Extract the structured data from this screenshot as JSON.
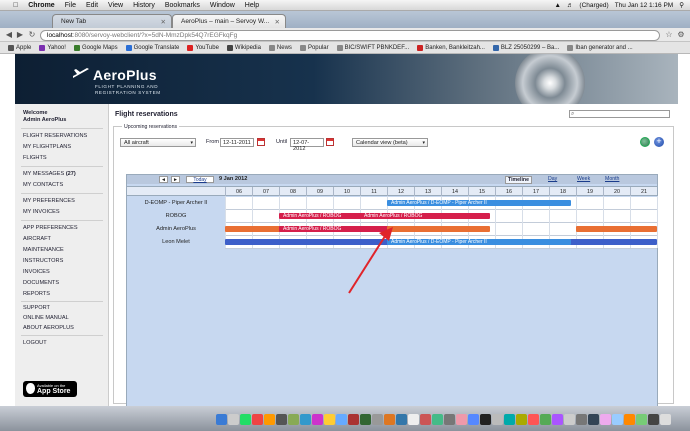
{
  "menubar": {
    "apple": "",
    "items": [
      "Chrome",
      "File",
      "Edit",
      "View",
      "History",
      "Bookmarks",
      "Window",
      "Help"
    ],
    "right": {
      "battery": "(Charged)",
      "clock": "Thu Jan 12  1:16 PM"
    }
  },
  "tabs": [
    {
      "label": "New Tab"
    },
    {
      "label": "AeroPlus – main – Servoy W..."
    }
  ],
  "address": {
    "host": "localhost",
    "path": ":8080/servoy-webclient/?x=5dN-MmzDpk54Q7rEGFkqFg"
  },
  "bookmarks": [
    {
      "label": "Apple",
      "color": "#555"
    },
    {
      "label": "Yahoo!",
      "color": "#7b2fb0"
    },
    {
      "label": "Google Maps",
      "color": "#3a7d2c"
    },
    {
      "label": "Google Translate",
      "color": "#2b6fd6"
    },
    {
      "label": "YouTube",
      "color": "#d22"
    },
    {
      "label": "Wikipedia",
      "color": "#444"
    },
    {
      "label": "News",
      "color": "#888"
    },
    {
      "label": "Popular",
      "color": "#888"
    },
    {
      "label": "BIC/SWIFT PBNKDEF...",
      "color": "#888"
    },
    {
      "label": "Banken, Bankleitzah...",
      "color": "#c22"
    },
    {
      "label": "BLZ 25050299 – Ba...",
      "color": "#36a"
    },
    {
      "label": "Iban generator and ...",
      "color": "#888"
    }
  ],
  "header": {
    "logo_title": "AeroPlus",
    "logo_subtitle": "FLIGHT PLANNING AND REGISTRATION SYSTEM"
  },
  "sidebar": {
    "welcome": "Welcome",
    "user": "Admin AeroPlus",
    "group1": [
      "FLIGHT RESERVATIONS",
      "MY FLIGHTPLANS",
      "FLIGHTS"
    ],
    "messages_label": "MY MESSAGES",
    "messages_count": "(27)",
    "contacts": "MY CONTACTS",
    "group3": [
      "MY PREFERENCES",
      "MY INVOICES"
    ],
    "group4": [
      "APP PREFERENCES",
      "AIRCRAFT",
      "MAINTENANCE",
      "INSTRUCTORS",
      "INVOICES",
      "DOCUMENTS",
      "REPORTS"
    ],
    "group5": [
      "SUPPORT",
      "ONLINE MANUAL",
      "ABOUT AEROPLUS"
    ],
    "logout": "LOGOUT",
    "appstore_line1": "Available on the",
    "appstore_line2": "App Store"
  },
  "main": {
    "title": "Flight reservations",
    "search_placeholder": "",
    "legend": "Upcoming reservations",
    "aircraft_select": "All aircraft",
    "from_label": "From",
    "from_value": "12-11-2011",
    "until_label": "Until",
    "until_value": "12-07-2012",
    "view_select": "Calendar view (beta)"
  },
  "calendar": {
    "today_label": "Today",
    "prev_label": "◄",
    "next_label": "►",
    "date_title": "9 Jan 2012",
    "views": [
      "Timeline",
      "Day",
      "Week",
      "Month"
    ],
    "active_view": "Timeline",
    "days": [
      "06",
      "07",
      "08",
      "09",
      "10",
      "11",
      "12",
      "13",
      "14",
      "15",
      "16",
      "17",
      "18",
      "19",
      "20",
      "21"
    ],
    "rows": [
      {
        "label": "D-EOMP - Piper Archer II"
      },
      {
        "label": "ROBOG"
      },
      {
        "label": "Admin AeroPlus"
      },
      {
        "label": "Leon Melet"
      }
    ],
    "bars": [
      {
        "row": 0,
        "start": 12,
        "end": 17.8,
        "label": "Admin AeroPlus / D-EOMP - Piper Archer II",
        "color": "#3a8ee0"
      },
      {
        "row": 1,
        "start": 8,
        "end": 13.8,
        "label": "Admin AeroPlus / ROBOG",
        "color": "#d51f4b"
      },
      {
        "row": 1,
        "start": 11,
        "end": 14.8,
        "label": "Admin AeroPlus / ROBOG",
        "color": "#d51f4b"
      },
      {
        "row": 2,
        "start": 6,
        "end": 7.5,
        "label": "",
        "color": "#e96f33"
      },
      {
        "row": 2,
        "start": 8,
        "end": 13.8,
        "label": "Admin AeroPlus / ROBOG",
        "color": "#d51f4b"
      },
      {
        "row": 2,
        "start": 12,
        "end": 14.8,
        "label": "",
        "color": "#e96f33"
      },
      {
        "row": 2,
        "start": 19,
        "end": 21.9,
        "label": "",
        "color": "#e96f33"
      },
      {
        "row": 3,
        "start": 6,
        "end": 21.9,
        "label": "",
        "color": "#3d5fc9"
      },
      {
        "row": 3,
        "start": 12,
        "end": 17.8,
        "label": "Admin AeroPlus / D-EOMP - Piper Archer II",
        "color": "#3a8ee0"
      }
    ]
  }
}
